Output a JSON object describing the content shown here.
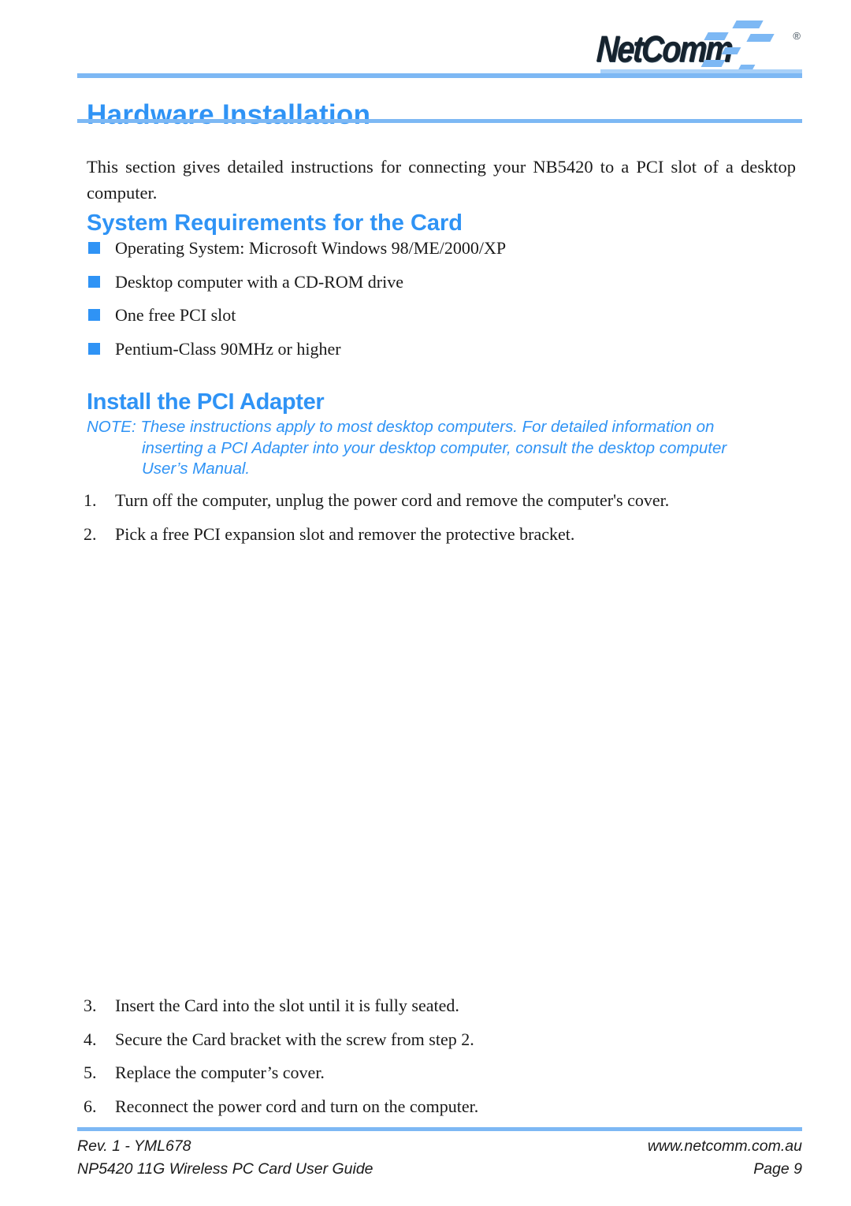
{
  "brand": {
    "logo_text": "NetComm",
    "registered_mark": "®",
    "accent_color": "#7db8f4",
    "heading_color": "#2f93f5"
  },
  "header": {
    "title": "Hardware Installation"
  },
  "intro": {
    "paragraph": "This section gives detailed instructions for connecting your NB5420 to a PCI slot of a desktop computer."
  },
  "sections": {
    "system_requirements": {
      "heading": "System Requirements for the Card",
      "bullets": [
        "Operating System: Microsoft Windows 98/ME/2000/XP",
        "Desktop computer with a CD-ROM drive",
        "One free PCI slot",
        "Pentium-Class 90MHz or higher"
      ]
    },
    "install_pci_adapter": {
      "heading": "Install the PCI Adapter",
      "note": {
        "line1": "NOTE: These instructions apply to most desktop computers.  For detailed information on",
        "line2": "inserting a PCI Adapter into your desktop computer, consult the desktop computer",
        "line3": "User’s Manual."
      },
      "steps_top": [
        {
          "number": "1.",
          "text": "Turn off the computer, unplug the power cord and remove the computer's cover."
        },
        {
          "number": "2.",
          "text": "Pick a free PCI expansion slot and remover the protective bracket."
        }
      ],
      "steps_bottom": [
        {
          "number": "3.",
          "text": "Insert the Card into the slot until it is fully seated."
        },
        {
          "number": "4.",
          "text": "Secure the Card bracket with the screw from step 2."
        },
        {
          "number": "5.",
          "text": "Replace the computer’s cover."
        },
        {
          "number": "6.",
          "text": "Reconnect the power cord and turn on the computer."
        }
      ]
    }
  },
  "footer": {
    "revision": "Rev. 1 - YML678",
    "website": "www.netcomm.com.au",
    "document_title": "NP5420 11G Wireless PC Card User Guide",
    "page_label": "Page 9"
  }
}
